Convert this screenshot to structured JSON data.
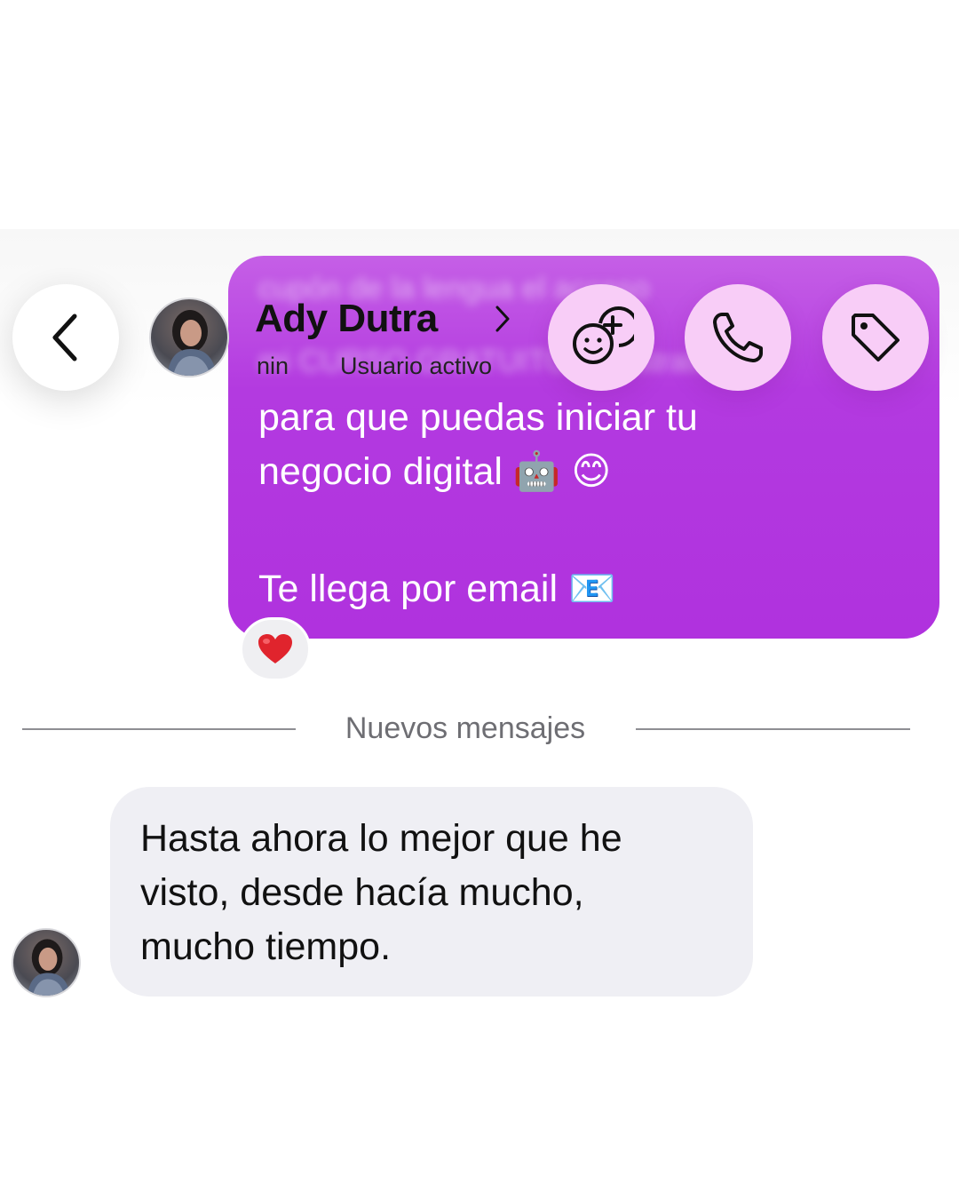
{
  "header": {
    "contact_name": "Ady Dutra",
    "status_prefix": "nin",
    "status": "Usuario activo",
    "back_icon": "chevron-left-icon",
    "actions": [
      {
        "name": "add-people-button",
        "icon": "add-group-icon"
      },
      {
        "name": "call-button",
        "icon": "phone-icon"
      },
      {
        "name": "tag-button",
        "icon": "tag-icon"
      }
    ]
  },
  "sent_message": {
    "blurred_lines": [
      "cupón de la lengua el acceso",
      "mi CURSO GRATUITO de estrategias"
    ],
    "lines": [
      "para que puedas iniciar tu",
      "negocio digital 🤖 😊",
      "Te llega por email 📧"
    ],
    "reaction": "❤️"
  },
  "divider": {
    "label": "Nuevos mensajes"
  },
  "received_message": {
    "lines": [
      "Hasta ahora lo mejor que he",
      "visto, desde hacía mucho,",
      "mucho tiempo."
    ]
  },
  "colors": {
    "sent_bubble": "#b032de",
    "action_button": "#f8cdf7",
    "received_bubble": "#efeff4"
  }
}
